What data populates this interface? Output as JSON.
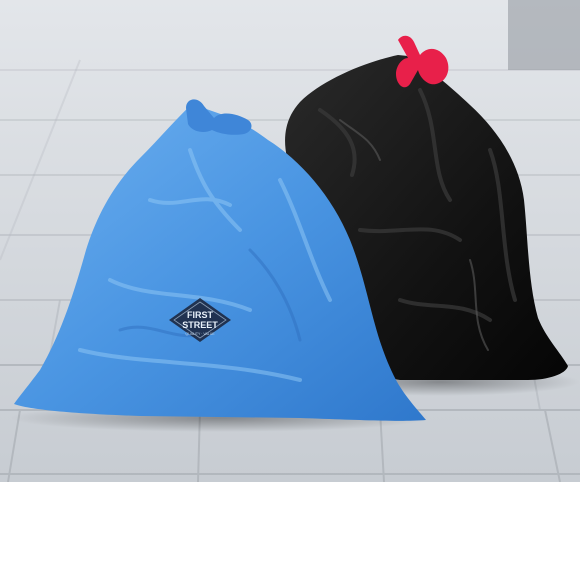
{
  "photo": {
    "subject": "two drawstring trash bags on a tiled pavement",
    "bags": [
      {
        "id": "blue-bag",
        "color": "#4f98e3",
        "tie_color": "#3f86d8"
      },
      {
        "id": "black-bag",
        "color": "#121212",
        "tie_color": "#e8204a"
      }
    ],
    "pavement_color": "#cfd3d8",
    "grout_color": "#a8adb3",
    "background": "#ffffff"
  },
  "logo": {
    "line1": "FIRST",
    "line2": "STREET",
    "tagline": "QUALITY · VALUE",
    "color": "#1d2a44"
  }
}
